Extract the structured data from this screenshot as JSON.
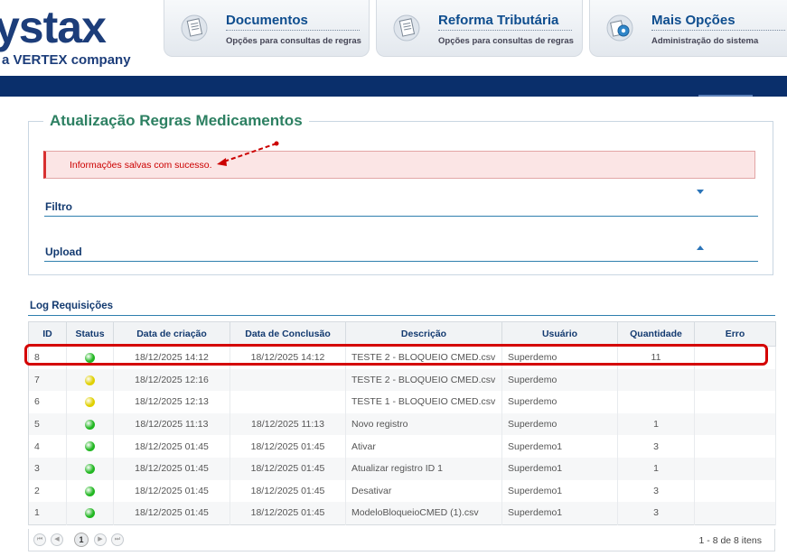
{
  "header": {
    "logo_main": "ystax",
    "logo_sub": "a VERTEX company",
    "tabs": [
      {
        "title": "Documentos",
        "subtitle": "Opções para consultas de regras",
        "icon": "document-icon"
      },
      {
        "title": "Reforma Tributária",
        "subtitle": "Opções para consultas de regras",
        "icon": "document-icon"
      },
      {
        "title": "Mais Opções",
        "subtitle": "Administração do sistema",
        "icon": "gear-icon"
      }
    ]
  },
  "panel": {
    "title": "Atualização Regras Medicamentos",
    "alert": "Informações salvas com sucesso.",
    "filter_label": "Filtro",
    "upload_label": "Upload"
  },
  "log": {
    "title": "Log Requisições",
    "columns": [
      "ID",
      "Status",
      "Data de criação",
      "Data de Conclusão",
      "Descrição",
      "Usuário",
      "Quantidade",
      "Erro"
    ],
    "rows": [
      {
        "id": "8",
        "status_color": "#22b722",
        "created": "18/12/2025 14:12",
        "concluded": "18/12/2025 14:12",
        "desc": "TESTE 2 - BLOQUEIO CMED.csv",
        "user": "Superdemo",
        "qty": "11",
        "error": ""
      },
      {
        "id": "7",
        "status_color": "#e0d000",
        "created": "18/12/2025 12:16",
        "concluded": "",
        "desc": "TESTE 2 - BLOQUEIO CMED.csv",
        "user": "Superdemo",
        "qty": "",
        "error": ""
      },
      {
        "id": "6",
        "status_color": "#e0d000",
        "created": "18/12/2025 12:13",
        "concluded": "",
        "desc": "TESTE 1 - BLOQUEIO CMED.csv",
        "user": "Superdemo",
        "qty": "",
        "error": ""
      },
      {
        "id": "5",
        "status_color": "#22b722",
        "created": "18/12/2025 11:13",
        "concluded": "18/12/2025 11:13",
        "desc": "Novo registro",
        "user": "Superdemo",
        "qty": "1",
        "error": ""
      },
      {
        "id": "4",
        "status_color": "#22b722",
        "created": "18/12/2025 01:45",
        "concluded": "18/12/2025 01:45",
        "desc": "Ativar",
        "user": "Superdemo1",
        "qty": "3",
        "error": ""
      },
      {
        "id": "3",
        "status_color": "#22b722",
        "created": "18/12/2025 01:45",
        "concluded": "18/12/2025 01:45",
        "desc": "Atualizar registro ID 1",
        "user": "Superdemo1",
        "qty": "1",
        "error": ""
      },
      {
        "id": "2",
        "status_color": "#22b722",
        "created": "18/12/2025 01:45",
        "concluded": "18/12/2025 01:45",
        "desc": "Desativar",
        "user": "Superdemo1",
        "qty": "3",
        "error": ""
      },
      {
        "id": "1",
        "status_color": "#22b722",
        "created": "18/12/2025 01:45",
        "concluded": "18/12/2025 01:45",
        "desc": "ModeloBloqueioCMED (1).csv",
        "user": "Superdemo1",
        "qty": "3",
        "error": ""
      }
    ],
    "pager": {
      "current_page": "1",
      "info": "1 - 8 de 8 itens"
    }
  }
}
